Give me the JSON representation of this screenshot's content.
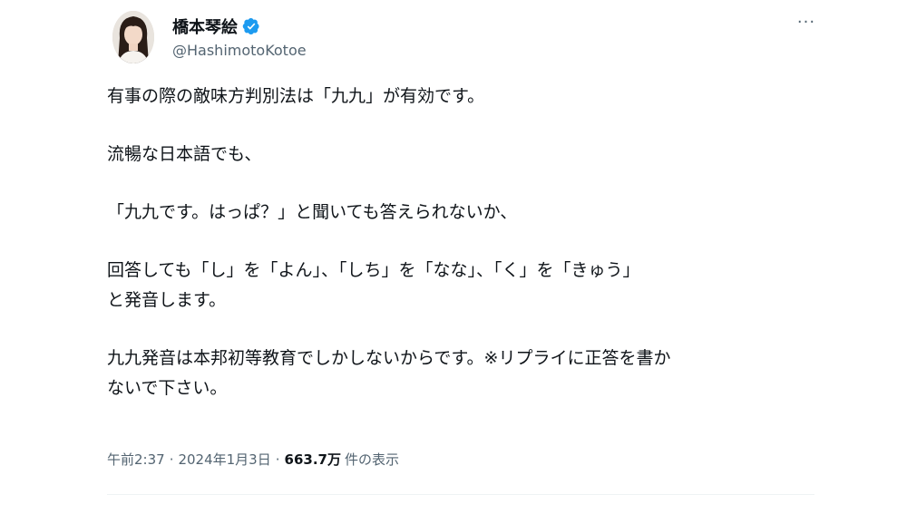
{
  "author": {
    "display_name": "橋本琴絵",
    "handle": "@HashimotoKotoe",
    "verified": true
  },
  "more_label": "···",
  "tweet": {
    "paragraphs": [
      "有事の際の敵味方判別法は「九九」が有効です。",
      "流暢な日本語でも、",
      "「九九です。はっぱ？」と聞いても答えられないか、",
      "回答しても「し」を「よん」、「しち」を「なな」、「く」を「きゅう」\nと発音します。",
      "九九発音は本邦初等教育でしかしないからです。※リプライに正答を書か\nないで下さい。"
    ]
  },
  "meta": {
    "time": "午前2:37",
    "separator": "·",
    "date": "2024年1月3日",
    "views_count": "663.7万",
    "views_label": "件の表示"
  },
  "colors": {
    "verified": "#1d9bf0",
    "text": "#0f1419",
    "secondary": "#536471"
  }
}
